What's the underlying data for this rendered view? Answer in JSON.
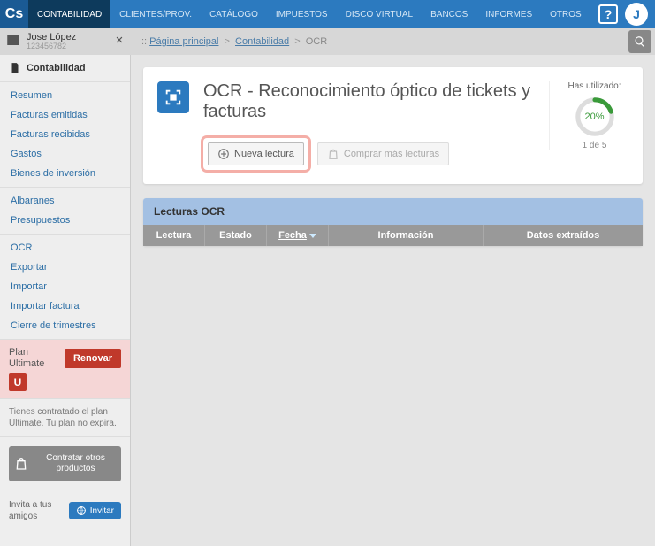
{
  "logo": "Cs",
  "topnav": {
    "items": [
      {
        "label": "CONTABILIDAD",
        "active": true
      },
      {
        "label": "CLIENTES/PROV."
      },
      {
        "label": "CATÁLOGO"
      },
      {
        "label": "IMPUESTOS"
      },
      {
        "label": "DISCO VIRTUAL"
      },
      {
        "label": "BANCOS"
      },
      {
        "label": "INFORMES"
      },
      {
        "label": "OTROS"
      }
    ]
  },
  "help_glyph": "?",
  "avatar_initial": "J",
  "user": {
    "name": "Jose López",
    "id": "123456782"
  },
  "breadcrumb": {
    "prefix": ":: ",
    "items": [
      "Página principal",
      "Contabilidad"
    ],
    "current": "OCR",
    "sep": ">"
  },
  "sidebar": {
    "heading": "Contabilidad",
    "group1": [
      "Resumen",
      "Facturas emitidas",
      "Facturas recibidas",
      "Gastos",
      "Bienes de inversión"
    ],
    "group2": [
      "Albaranes",
      "Presupuestos"
    ],
    "group3": [
      "OCR",
      "Exportar",
      "Importar",
      "Importar factura",
      "Cierre de trimestres"
    ]
  },
  "plan": {
    "label_line1": "Plan",
    "label_line2": "Ultimate",
    "renew": "Renovar",
    "badge": "U",
    "desc": "Tienes contratado el plan Ultimate. Tu plan no expira."
  },
  "contract_btn": "Contratar otros productos",
  "invite": {
    "label": "Invita a tus amigos",
    "btn": "Invitar"
  },
  "page": {
    "title": "OCR - Reconocimiento óptico de tickets y facturas",
    "new_read": "Nueva lectura",
    "buy_more": "Comprar más lecturas",
    "usage_title": "Has utilizado:",
    "usage_pct": "20%",
    "usage_count": "1 de 5",
    "table_title": "Lecturas OCR",
    "cols": {
      "lectura": "Lectura",
      "estado": "Estado",
      "fecha": "Fecha",
      "info": "Información",
      "datos": "Datos extraídos"
    }
  },
  "chart_data": {
    "type": "pie",
    "title": "Has utilizado:",
    "values": [
      20,
      80
    ],
    "categories": [
      "used",
      "remaining"
    ],
    "used_count": 1,
    "total_count": 5
  }
}
